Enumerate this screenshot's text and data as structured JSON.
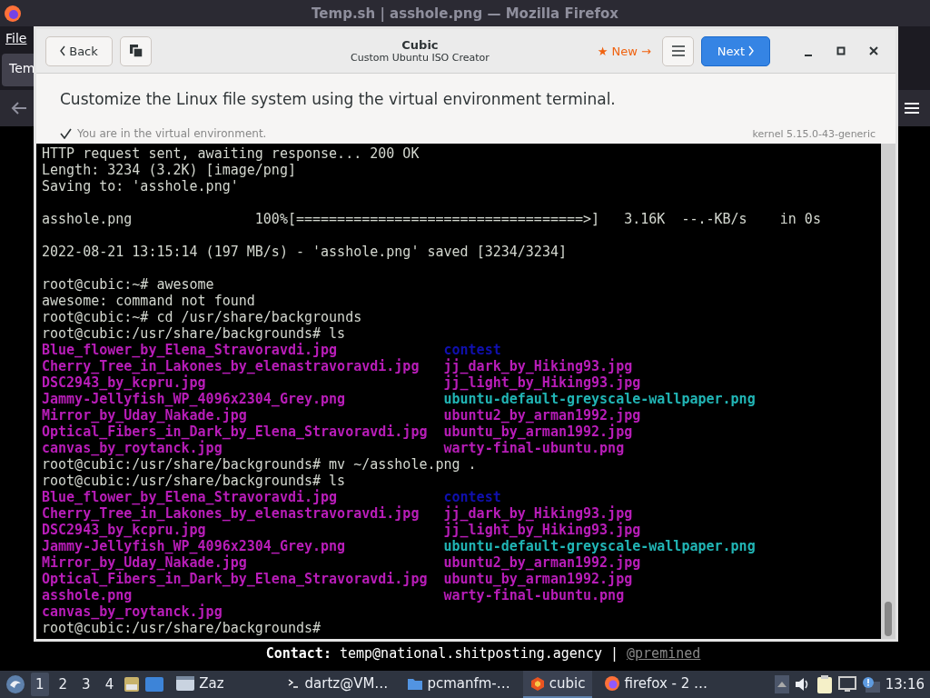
{
  "browser": {
    "title": "Temp.sh | asshole.png — Mozilla Firefox",
    "menu": [
      "File"
    ],
    "tab": {
      "label": "Tem",
      "selected": true
    },
    "contact": {
      "text": "**Contact:** temp@national.shitposting.agency | ",
      "link": "@premined"
    }
  },
  "cubic": {
    "back": "Back",
    "title": "Cubic",
    "subtitle": "Custom Ubuntu ISO Creator",
    "new_badge": "★ New →",
    "next": "Next",
    "heading": "Customize the Linux file system using the virtual environment terminal.",
    "status": "You are in the virtual environment.",
    "kernel": "kernel 5.15.0-43-generic",
    "terminal": [
      {
        "kind": "text",
        "cells": [
          {
            "kind": "text",
            "text": "HTTP request sent, awaiting response... 200 OK"
          }
        ]
      },
      {
        "kind": "text",
        "cells": [
          {
            "kind": "text",
            "text": "Length: 3234 (3.2K) [image/png]"
          }
        ]
      },
      {
        "kind": "text",
        "cells": [
          {
            "kind": "text",
            "text": "Saving to: 'asshole.png'"
          }
        ]
      },
      {
        "kind": "blank"
      },
      {
        "kind": "text",
        "cells": [
          {
            "kind": "text",
            "text": "asshole.png               100%[===================================>]   3.16K  --.-KB/s    in 0s"
          }
        ]
      },
      {
        "kind": "blank"
      },
      {
        "kind": "text",
        "cells": [
          {
            "kind": "text",
            "text": "2022-08-21 13:15:14 (197 MB/s) - 'asshole.png' saved [3234/3234]"
          }
        ]
      },
      {
        "kind": "blank"
      },
      {
        "kind": "text",
        "cells": [
          {
            "kind": "text",
            "text": "root@cubic:~# awesome"
          }
        ]
      },
      {
        "kind": "text",
        "cells": [
          {
            "kind": "text",
            "text": "awesome: command not found"
          }
        ]
      },
      {
        "kind": "text",
        "cells": [
          {
            "kind": "text",
            "text": "root@cubic:~# cd /usr/share/backgrounds"
          }
        ]
      },
      {
        "kind": "text",
        "cells": [
          {
            "kind": "text",
            "text": "root@cubic:/usr/share/backgrounds# ls"
          }
        ]
      },
      {
        "kind": "text",
        "cells": [
          {
            "kind": "image",
            "text": "Blue_flower_by_Elena_Stravoravdi.jpg"
          },
          {
            "kind": "dir",
            "text": "contest"
          }
        ]
      },
      {
        "kind": "text",
        "cells": [
          {
            "kind": "image",
            "text": "Cherry_Tree_in_Lakones_by_elenastravoravdi.jpg"
          },
          {
            "kind": "image",
            "text": "jj_dark_by_Hiking93.jpg"
          }
        ]
      },
      {
        "kind": "text",
        "cells": [
          {
            "kind": "image",
            "text": "DSC2943_by_kcpru.jpg"
          },
          {
            "kind": "image",
            "text": "jj_light_by_Hiking93.jpg"
          }
        ]
      },
      {
        "kind": "text",
        "cells": [
          {
            "kind": "image",
            "text": "Jammy-Jellyfish_WP_4096x2304_Grey.png"
          },
          {
            "kind": "link",
            "text": "ubuntu-default-greyscale-wallpaper.png"
          }
        ]
      },
      {
        "kind": "text",
        "cells": [
          {
            "kind": "image",
            "text": "Mirror_by_Uday_Nakade.jpg"
          },
          {
            "kind": "image",
            "text": "ubuntu2_by_arman1992.jpg"
          }
        ]
      },
      {
        "kind": "text",
        "cells": [
          {
            "kind": "image",
            "text": "Optical_Fibers_in_Dark_by_Elena_Stravoravdi.jpg"
          },
          {
            "kind": "image",
            "text": "ubuntu_by_arman1992.jpg"
          }
        ]
      },
      {
        "kind": "text",
        "cells": [
          {
            "kind": "image",
            "text": "canvas_by_roytanck.jpg"
          },
          {
            "kind": "image",
            "text": "warty-final-ubuntu.png"
          }
        ]
      },
      {
        "kind": "text",
        "cells": [
          {
            "kind": "text",
            "text": "root@cubic:/usr/share/backgrounds# mv ~/asshole.png ."
          }
        ]
      },
      {
        "kind": "text",
        "cells": [
          {
            "kind": "text",
            "text": "root@cubic:/usr/share/backgrounds# ls"
          }
        ]
      },
      {
        "kind": "text",
        "cells": [
          {
            "kind": "image",
            "text": "Blue_flower_by_Elena_Stravoravdi.jpg"
          },
          {
            "kind": "dir",
            "text": "contest"
          }
        ]
      },
      {
        "kind": "text",
        "cells": [
          {
            "kind": "image",
            "text": "Cherry_Tree_in_Lakones_by_elenastravoravdi.jpg"
          },
          {
            "kind": "image",
            "text": "jj_dark_by_Hiking93.jpg"
          }
        ]
      },
      {
        "kind": "text",
        "cells": [
          {
            "kind": "image",
            "text": "DSC2943_by_kcpru.jpg"
          },
          {
            "kind": "image",
            "text": "jj_light_by_Hiking93.jpg"
          }
        ]
      },
      {
        "kind": "text",
        "cells": [
          {
            "kind": "image",
            "text": "Jammy-Jellyfish_WP_4096x2304_Grey.png"
          },
          {
            "kind": "link",
            "text": "ubuntu-default-greyscale-wallpaper.png"
          }
        ]
      },
      {
        "kind": "text",
        "cells": [
          {
            "kind": "image",
            "text": "Mirror_by_Uday_Nakade.jpg"
          },
          {
            "kind": "image",
            "text": "ubuntu2_by_arman1992.jpg"
          }
        ]
      },
      {
        "kind": "text",
        "cells": [
          {
            "kind": "image",
            "text": "Optical_Fibers_in_Dark_by_Elena_Stravoravdi.jpg"
          },
          {
            "kind": "image",
            "text": "ubuntu_by_arman1992.jpg"
          }
        ]
      },
      {
        "kind": "text",
        "cells": [
          {
            "kind": "image",
            "text": "asshole.png"
          },
          {
            "kind": "image",
            "text": "warty-final-ubuntu.png"
          }
        ]
      },
      {
        "kind": "text",
        "cells": [
          {
            "kind": "image",
            "text": "canvas_by_roytanck.jpg"
          }
        ]
      },
      {
        "kind": "text",
        "cells": [
          {
            "kind": "text",
            "text": "root@cubic:/usr/share/backgrounds#"
          }
        ]
      }
    ]
  },
  "taskbar": {
    "workspaces": [
      {
        "label": "1",
        "selected": true
      },
      {
        "label": "2",
        "selected": false
      },
      {
        "label": "3",
        "selected": false
      },
      {
        "label": "4",
        "selected": false
      }
    ],
    "launch": "Zaz",
    "tasks": [
      {
        "label": "dartz@VM…",
        "kind": "terminal",
        "selected": false
      },
      {
        "label": "pcmanfm-…",
        "kind": "folder",
        "selected": false
      },
      {
        "label": "cubic",
        "kind": "cubic",
        "selected": true
      },
      {
        "label": "firefox - 2 …",
        "kind": "browser",
        "selected": false
      }
    ],
    "clock": "13:16"
  }
}
